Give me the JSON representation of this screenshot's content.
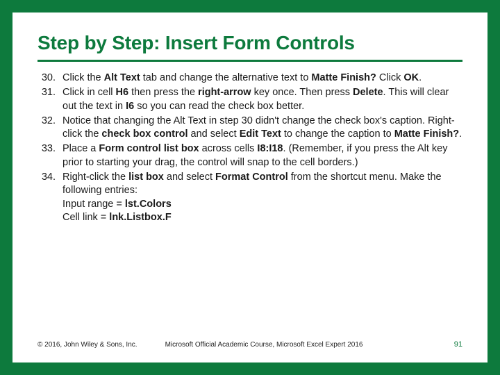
{
  "title": "Step by Step: Insert Form Controls",
  "items": [
    {
      "n": "30.",
      "html": "Click the <b>Alt Text</b> tab and change the alternative text to <b>Matte Finish?</b> Click <b>OK</b>."
    },
    {
      "n": "31.",
      "html": "Click in cell <b>H6</b> then press the <b>right-arrow</b> key once. Then press <b>Delete</b>. This will clear out the text in <b>I6</b> so you can read the check box better."
    },
    {
      "n": "32.",
      "html": "Notice that changing the Alt Text in step 30 didn't change the check box's caption. Right-click the <b>check box control</b> and select <b>Edit Text</b> to change the caption to <b>Matte Finish?</b>."
    },
    {
      "n": "33.",
      "html": "Place a <b>Form control list box</b> across cells <b>I8:I18</b>. (Remember, if you press the Alt key prior to starting your drag, the control will snap to the cell borders.)"
    },
    {
      "n": "34.",
      "html": "Right-click the <b>list box</b> and select <b>Format Control</b> from the shortcut menu. Make the following entries:<br>Input range = <b>lst.Colors</b><br>Cell link = <b>lnk.Listbox.F</b>"
    }
  ],
  "footer": {
    "copyright": "© 2016, John Wiley & Sons, Inc.",
    "course": "Microsoft Official Academic Course, Microsoft Excel Expert 2016",
    "page": "91"
  }
}
